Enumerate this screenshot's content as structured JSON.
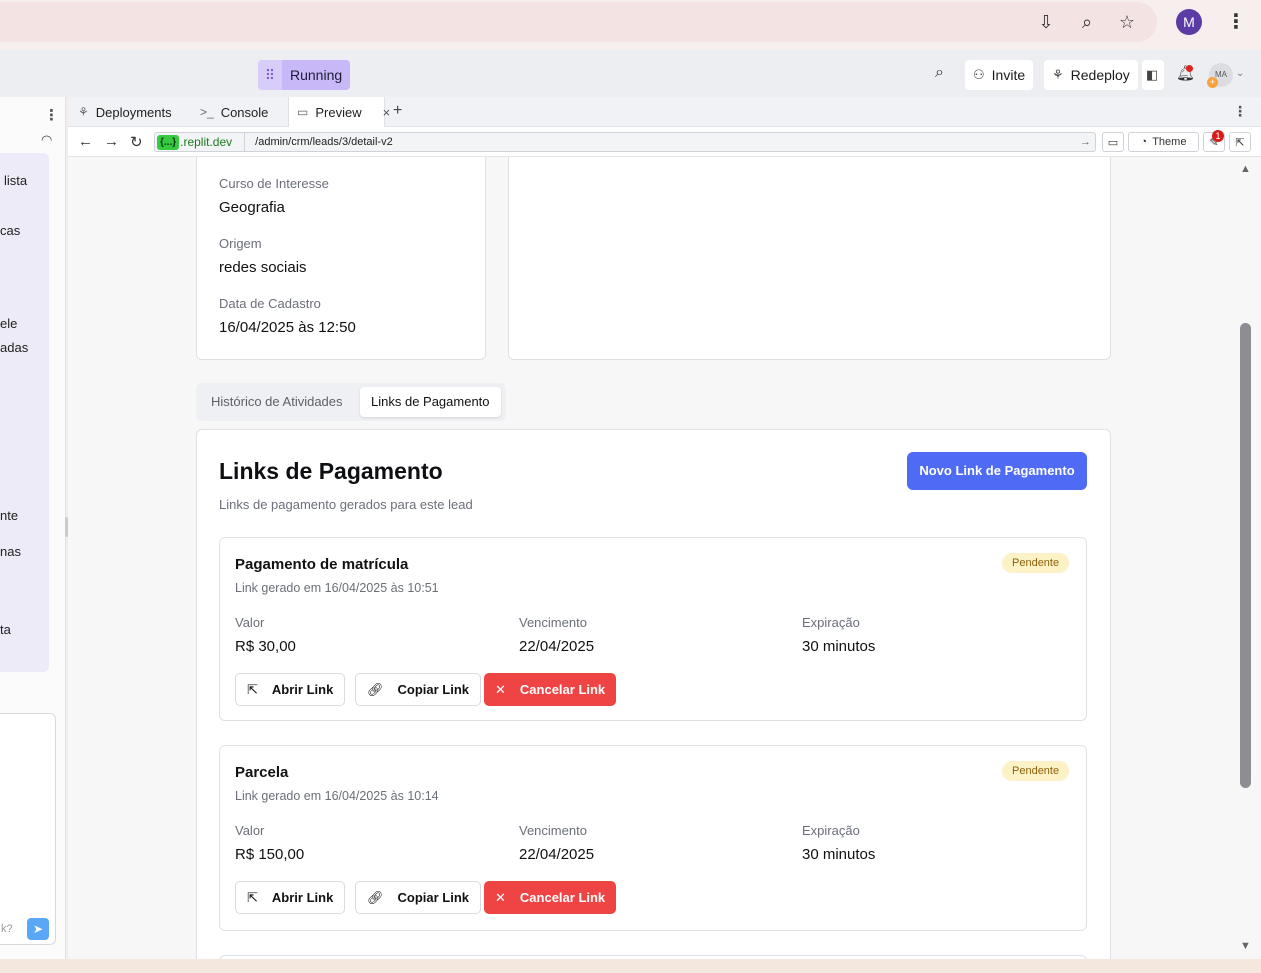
{
  "browser": {
    "icons": [
      "install-icon",
      "zoom-icon",
      "bookmark-star-icon"
    ],
    "profile_initial": "M"
  },
  "replit": {
    "status": "Running",
    "invite_label": "Invite",
    "redeploy_label": "Redeploy",
    "user_initials": "MA"
  },
  "left_panel": {
    "fragments": [
      "lista",
      "cas",
      "ele",
      "adas",
      "nte",
      "nas",
      "ta"
    ],
    "input_placeholder": "k?"
  },
  "tabs": [
    {
      "label": "Deployments"
    },
    {
      "label": "Console"
    },
    {
      "label": "Preview"
    }
  ],
  "address": {
    "repl_tag": "{...}",
    "host": ".replit.dev",
    "path": "/admin/crm/leads/3/detail-v2",
    "theme_label": "Theme",
    "notification_count": "1"
  },
  "lead_info": [
    {
      "label": "Curso de Interesse",
      "value": "Geografia"
    },
    {
      "label": "Origem",
      "value": "redes sociais"
    },
    {
      "label": "Data de Cadastro",
      "value": "16/04/2025 às 12:50"
    }
  ],
  "content_tabs": [
    {
      "label": "Histórico de Atividades"
    },
    {
      "label": "Links de Pagamento"
    }
  ],
  "payments": {
    "title": "Links de Pagamento",
    "subtitle": "Links de pagamento gerados para este lead",
    "new_button": "Novo Link de Pagamento",
    "field_labels": {
      "valor": "Valor",
      "vencimento": "Vencimento",
      "expiracao": "Expiração"
    },
    "actions": {
      "open": "Abrir Link",
      "copy": "Copiar Link",
      "cancel": "Cancelar Link"
    },
    "items": [
      {
        "title": "Pagamento de matrícula",
        "generated": "Link gerado em 16/04/2025 às 10:51",
        "status": "Pendente",
        "valor": "R$ 30,00",
        "vencimento": "22/04/2025",
        "expiracao": "30 minutos"
      },
      {
        "title": "Parcela",
        "generated": "Link gerado em 16/04/2025 às 10:14",
        "status": "Pendente",
        "valor": "R$ 150,00",
        "vencimento": "22/04/2025",
        "expiracao": "30 minutos"
      }
    ]
  },
  "colors": {
    "primary": "#4f6bf5",
    "danger": "#ef4444",
    "pending_bg": "#fcf2c6",
    "pending_text": "#8b6109",
    "running": "#c9b8f7"
  }
}
